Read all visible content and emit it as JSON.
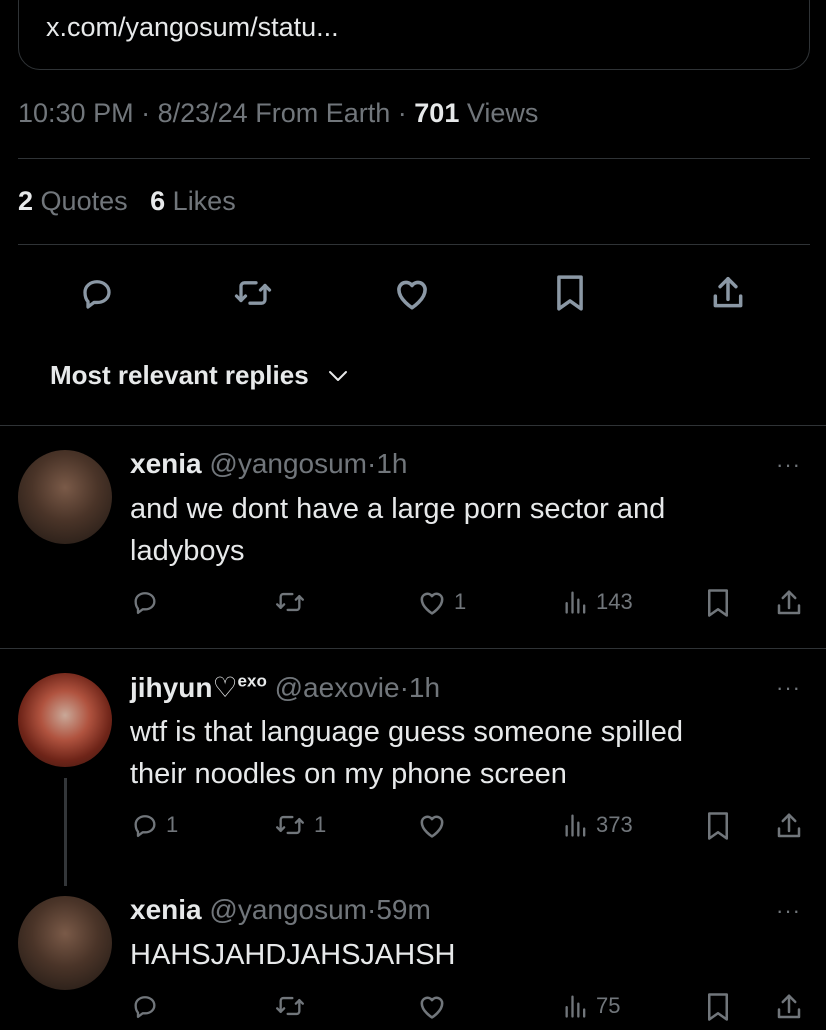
{
  "link_card": {
    "url_text": "x.com/yangosum/statu..."
  },
  "meta": {
    "time": "10:30 PM",
    "date": "8/23/24",
    "source": "From Earth",
    "views_count": "701",
    "views_label": "Views"
  },
  "stats": {
    "quotes_count": "2",
    "quotes_label": "Quotes",
    "likes_count": "6",
    "likes_label": "Likes"
  },
  "main_actions": [
    "reply-icon",
    "retweet-icon",
    "like-icon",
    "bookmark-icon",
    "share-icon"
  ],
  "sort": {
    "label": "Most relevant replies"
  },
  "replies": [
    {
      "name": "xenia",
      "handle": "@yangosum",
      "time": "1h",
      "text_line1": "and we dont have a large porn sector and",
      "text_line2": "ladyboys",
      "reply_count": "",
      "retweet_count": "",
      "like_count": "1",
      "views": "143"
    },
    {
      "name": "jihyun♡",
      "name_suffix": "exo",
      "handle": "@aexovie",
      "time": "1h",
      "text_line1": "wtf is that language guess someone spilled",
      "text_line2": "their noodles on my phone screen",
      "reply_count": "1",
      "retweet_count": "1",
      "like_count": "",
      "views": "373"
    },
    {
      "name": "xenia",
      "handle": "@yangosum",
      "time": "59m",
      "text_line1": "HAHSJAHDJAHSJAHSH",
      "text_line2": "",
      "reply_count": "",
      "retweet_count": "",
      "like_count": "",
      "views": "75"
    }
  ],
  "more_label": "···",
  "separator": "·"
}
